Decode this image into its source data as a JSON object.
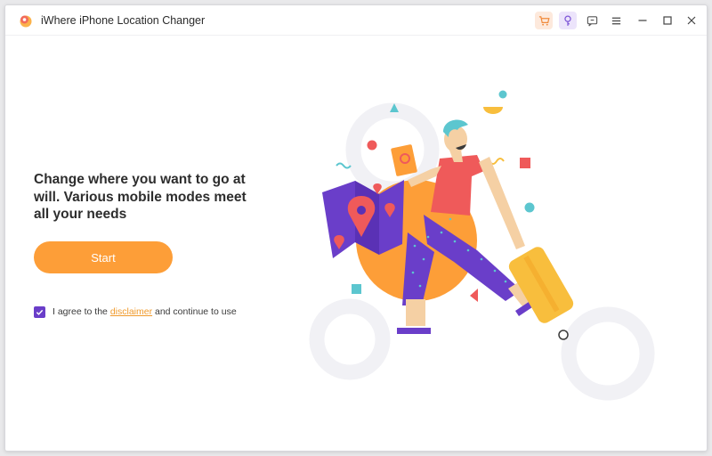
{
  "window": {
    "title": "iWhere iPhone Location Changer"
  },
  "toolbar": {
    "icons": [
      "cart-icon",
      "key-icon",
      "feedback-icon",
      "menu-icon",
      "minimize-icon",
      "maximize-icon",
      "close-icon"
    ]
  },
  "main": {
    "headline": "Change where you want to go at will. Various mobile modes meet all your needs",
    "start_label": "Start",
    "agree": {
      "checked": true,
      "prefix": "I agree to the",
      "link": "disclaimer",
      "suffix": "and continue to use"
    }
  },
  "colors": {
    "accent_orange": "#fd9e38",
    "checkbox_purple": "#6a3ec9",
    "link_orange": "#f09a2c"
  }
}
